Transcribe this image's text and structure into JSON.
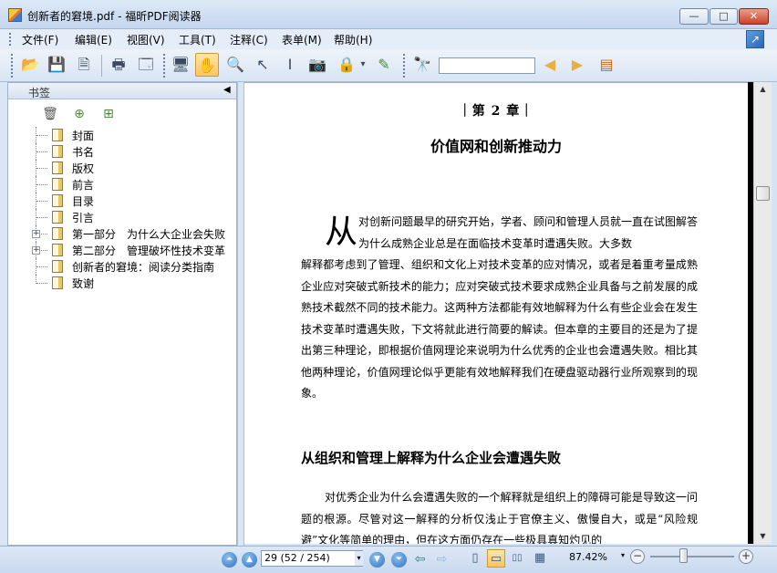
{
  "window": {
    "title": "创新者的窘境.pdf - 福昕PDF阅读器",
    "min_glyph": "—",
    "max_glyph": "□",
    "close_glyph": "✕"
  },
  "menu": {
    "items": [
      "文件(F)",
      "编辑(E)",
      "视图(V)",
      "工具(T)",
      "注释(C)",
      "表单(M)",
      "帮助(H)"
    ],
    "corner_glyph": "↗"
  },
  "toolbar": {
    "search_value": "",
    "icons": {
      "open": "📂",
      "save": "💾",
      "save_as": "🗎",
      "print": "🖶",
      "properties": "🗔",
      "fullscreen": "🖥",
      "hand": "✋",
      "zoom": "🔍",
      "select": "↖",
      "text_select": "Ⅰ",
      "snapshot": "📷",
      "rms": "🔒",
      "rms_dropdown": "▾",
      "sign": "✎",
      "find": "🔭",
      "search_prev": "◀",
      "search_next": "▶",
      "highlight": "▤"
    }
  },
  "sidebar": {
    "tools": [
      "▦",
      "🗋",
      "◇",
      "💬",
      "📎",
      "✍"
    ]
  },
  "bookmarks": {
    "title": "书签",
    "collapse_glyph": "◀",
    "tools": [
      "🗑",
      "⊕",
      "⊞"
    ],
    "items": [
      {
        "label": "封面",
        "expandable": false
      },
      {
        "label": "书名",
        "expandable": false
      },
      {
        "label": "版权",
        "expandable": false
      },
      {
        "label": "前言",
        "expandable": false
      },
      {
        "label": "目录",
        "expandable": false
      },
      {
        "label": "引言",
        "expandable": false
      },
      {
        "label": "第一部分　为什么大企业会失败",
        "expandable": true
      },
      {
        "label": "第二部分　管理破坏性技术变革",
        "expandable": true
      },
      {
        "label": "创新者的窘境：阅读分类指南",
        "expandable": false
      },
      {
        "label": "致谢",
        "expandable": false
      }
    ],
    "expander_glyph": "+"
  },
  "document": {
    "chapter_number": "｜第 2 章｜",
    "chapter_title": "价值网和创新推动力",
    "dropcap": "从",
    "para1_first": "对创新问题最早的研究开始，学者、顾问和管理人员就一直在试图解答为什么成熟企业总是在面临技术变革时遭遇失败。大多数",
    "para1_rest": "解释都考虑到了管理、组织和文化上对技术变革的应对情况，或者是着重考量成熟企业应对突破式新技术的能力；应对突破式技术要求成熟企业具备与之前发展的成熟技术截然不同的技术能力。这两种方法都能有效地解释为什么有些企业会在发生技术变革时遭遇失败，下文将就此进行简要的解读。但本章的主要目的还是为了提出第三种理论，即根据价值网理论来说明为什么优秀的企业也会遭遇失败。相比其他两种理论，价值网理论似乎更能有效地解释我们在硬盘驱动器行业所观察到的现象。",
    "section_title": "从组织和管理上解释为什么企业会遭遇失败",
    "para2": "对优秀企业为什么会遭遇失败的一个解释就是组织上的障碍可能是导致这一问题的根源。尽管对这一解释的分析仅浅止于官僚主义、傲慢自大，或是“风险规避”文化等简单的理由，但在这方面仍存在一些极具真知灼见的"
  },
  "scrollbar": {
    "up": "▲",
    "down": "▼"
  },
  "status": {
    "page_field": "29 (52 / 254)",
    "page_dd": "▾",
    "zoom": "87.42%",
    "zoom_dd": "▾",
    "zoom_minus": "−",
    "zoom_plus": "+",
    "nav": {
      "first": "⏶",
      "prev": "▲",
      "next": "▼",
      "last": "⏷",
      "back": "⇦",
      "forward": "⇨",
      "single": "▯",
      "continuous": "▭",
      "facing": "▯▯",
      "cont_facing": "▦"
    }
  }
}
